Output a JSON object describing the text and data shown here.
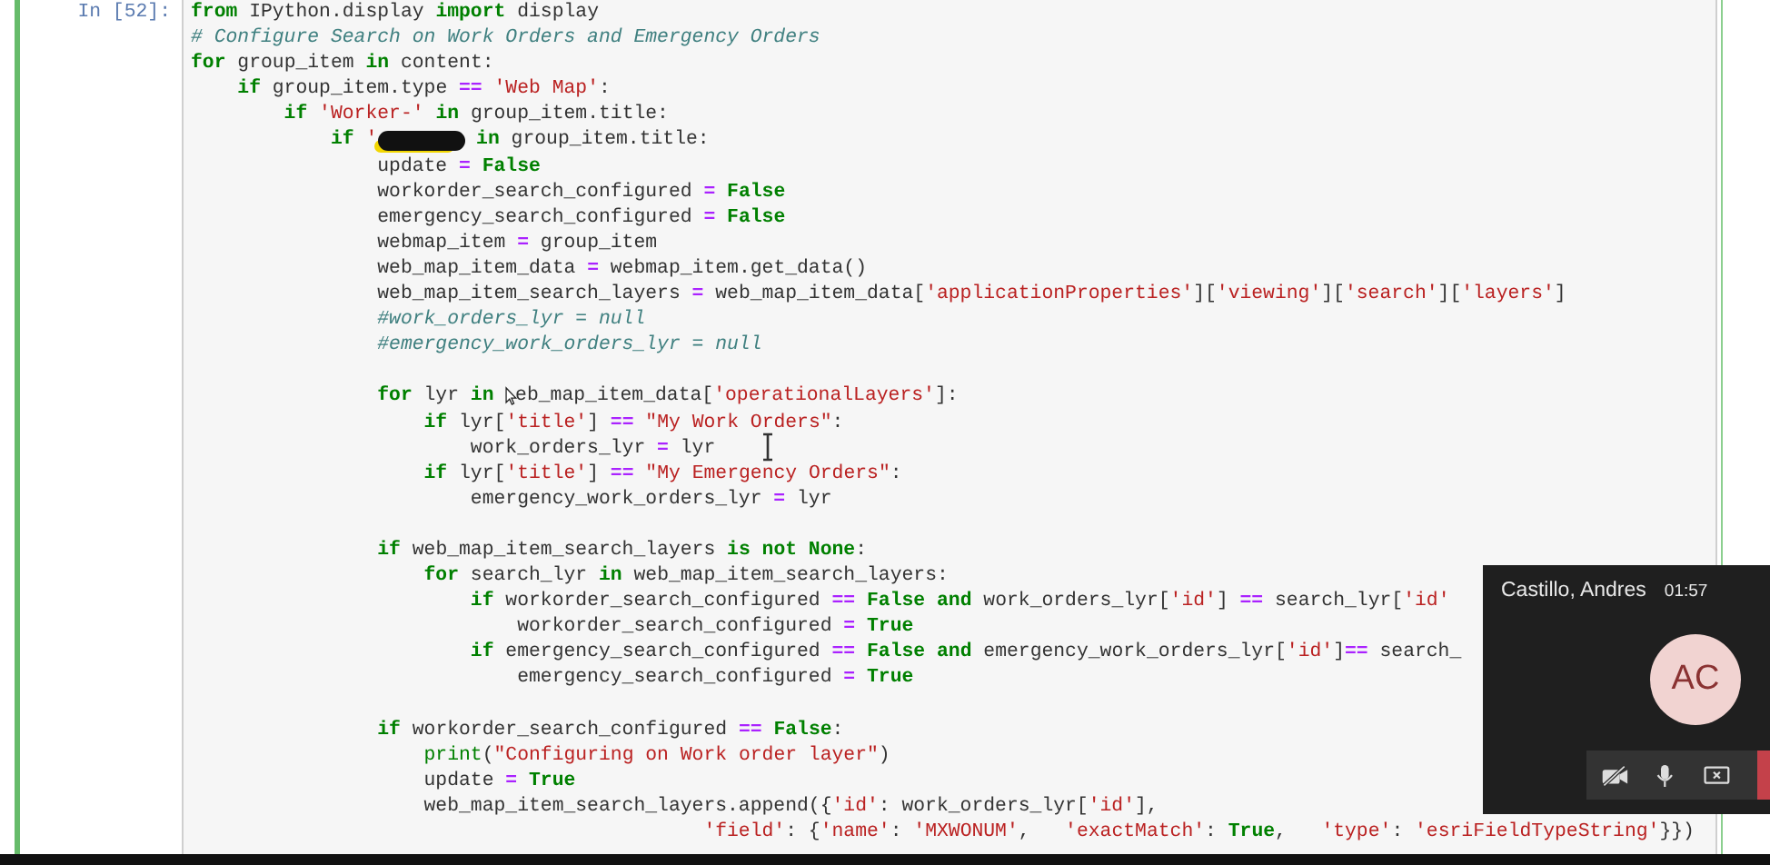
{
  "cell": {
    "prompt": "In [52]:",
    "blocks": [
      [
        [
          {
            "kind": "kw",
            "text": "from"
          },
          {
            "kind": "txt",
            "text": " IPython.display"
          },
          {
            "kind": "kw",
            "text": " import"
          },
          {
            "kind": "txt",
            "text": " display"
          }
        ],
        [
          {
            "kind": "com",
            "text": "# Configure Search on Work Orders and Emergency Orders"
          }
        ],
        [
          {
            "kind": "kw",
            "text": "for"
          },
          {
            "kind": "txt",
            "text": " group_item"
          },
          {
            "kind": "kw",
            "text": " in"
          },
          {
            "kind": "txt",
            "text": " content:"
          }
        ],
        [
          {
            "kind": "kw",
            "text": "    if"
          },
          {
            "kind": "txt",
            "text": " group_item.type"
          },
          {
            "kind": "op",
            "text": " =="
          },
          {
            "kind": "str",
            "text": " 'Web Map'"
          },
          {
            "kind": "txt",
            "text": ":"
          }
        ],
        [
          {
            "kind": "kw",
            "text": "        if"
          },
          {
            "kind": "str",
            "text": " 'Worker-'"
          },
          {
            "kind": "kw",
            "text": " in"
          },
          {
            "kind": "txt",
            "text": " group_item.title:"
          }
        ],
        [
          {
            "kind": "kw",
            "text": "            if"
          },
          {
            "kind": "str",
            "text": " '"
          },
          {
            "kind": "redact"
          },
          {
            "kind": "kw",
            "text": " in"
          },
          {
            "kind": "txt",
            "text": " group_item.title:"
          }
        ],
        [
          {
            "kind": "txt",
            "text": "                update"
          },
          {
            "kind": "op",
            "text": " ="
          },
          {
            "kind": "kw",
            "text": " False"
          }
        ],
        [
          {
            "kind": "txt",
            "text": "                workorder_search_configured"
          },
          {
            "kind": "op",
            "text": " ="
          },
          {
            "kind": "kw",
            "text": " False"
          }
        ],
        [
          {
            "kind": "txt",
            "text": "                emergency_search_configured"
          },
          {
            "kind": "op",
            "text": " ="
          },
          {
            "kind": "kw",
            "text": " False"
          }
        ],
        [
          {
            "kind": "txt",
            "text": "                webmap_item"
          },
          {
            "kind": "op",
            "text": " ="
          },
          {
            "kind": "txt",
            "text": " group_item"
          }
        ],
        [
          {
            "kind": "txt",
            "text": "                web_map_item_data"
          },
          {
            "kind": "op",
            "text": " ="
          },
          {
            "kind": "txt",
            "text": " webmap_item.get_data()"
          }
        ],
        [
          {
            "kind": "txt",
            "text": "                web_map_item_search_layers"
          },
          {
            "kind": "op",
            "text": " ="
          },
          {
            "kind": "txt",
            "text": " web_map_item_data["
          },
          {
            "kind": "str",
            "text": "'applicationProperties'"
          },
          {
            "kind": "txt",
            "text": "]["
          },
          {
            "kind": "str",
            "text": "'viewing'"
          },
          {
            "kind": "txt",
            "text": "]["
          },
          {
            "kind": "str",
            "text": "'search'"
          },
          {
            "kind": "txt",
            "text": "]["
          },
          {
            "kind": "str",
            "text": "'layers'"
          },
          {
            "kind": "txt",
            "text": "]"
          }
        ],
        [
          {
            "kind": "com",
            "text": "                #work_orders_lyr = null"
          }
        ],
        [
          {
            "kind": "com",
            "text": "                #emergency_work_orders_lyr = null"
          }
        ]
      ],
      [
        [
          {
            "kind": "kw",
            "text": "                for"
          },
          {
            "kind": "txt",
            "text": " lyr"
          },
          {
            "kind": "kw",
            "text": " in"
          },
          {
            "kind": "pointer"
          },
          {
            "kind": "txt",
            "text": "eb_map_item_data["
          },
          {
            "kind": "str",
            "text": "'operationalLayers'"
          },
          {
            "kind": "txt",
            "text": "]:"
          }
        ],
        [
          {
            "kind": "kw",
            "text": "                    if"
          },
          {
            "kind": "txt",
            "text": " lyr["
          },
          {
            "kind": "str",
            "text": "'title'"
          },
          {
            "kind": "txt",
            "text": "]"
          },
          {
            "kind": "op",
            "text": " =="
          },
          {
            "kind": "str",
            "text": " \"My Work Orders\""
          },
          {
            "kind": "txt",
            "text": ":"
          }
        ],
        [
          {
            "kind": "txt",
            "text": "                        work_orders_lyr"
          },
          {
            "kind": "op",
            "text": " ="
          },
          {
            "kind": "txt",
            "text": " lyr"
          }
        ],
        [
          {
            "kind": "kw",
            "text": "                    if"
          },
          {
            "kind": "txt",
            "text": " lyr["
          },
          {
            "kind": "str",
            "text": "'title'"
          },
          {
            "kind": "txt",
            "text": "]"
          },
          {
            "kind": "op",
            "text": " =="
          },
          {
            "kind": "str",
            "text": " \"My Emergency Orders\""
          },
          {
            "kind": "txt",
            "text": ":"
          }
        ],
        [
          {
            "kind": "txt",
            "text": "                        emergency_work_orders_lyr"
          },
          {
            "kind": "op",
            "text": " ="
          },
          {
            "kind": "txt",
            "text": " lyr"
          }
        ]
      ],
      [
        [
          {
            "kind": "kw",
            "text": "                if"
          },
          {
            "kind": "txt",
            "text": " web_map_item_search_layers"
          },
          {
            "kind": "kw",
            "text": " is not None"
          },
          {
            "kind": "txt",
            "text": ":"
          }
        ],
        [
          {
            "kind": "kw",
            "text": "                    for"
          },
          {
            "kind": "txt",
            "text": " search_lyr"
          },
          {
            "kind": "kw",
            "text": " in"
          },
          {
            "kind": "txt",
            "text": " web_map_item_search_layers:"
          }
        ],
        [
          {
            "kind": "kw",
            "text": "                        if"
          },
          {
            "kind": "txt",
            "text": " workorder_search_configured"
          },
          {
            "kind": "op",
            "text": " =="
          },
          {
            "kind": "kw",
            "text": " False and"
          },
          {
            "kind": "txt",
            "text": " work_orders_lyr["
          },
          {
            "kind": "str",
            "text": "'id'"
          },
          {
            "kind": "txt",
            "text": "]"
          },
          {
            "kind": "op",
            "text": " =="
          },
          {
            "kind": "txt",
            "text": " search_lyr["
          },
          {
            "kind": "str",
            "text": "'id'"
          }
        ],
        [
          {
            "kind": "txt",
            "text": "                            workorder_search_configured"
          },
          {
            "kind": "op",
            "text": " ="
          },
          {
            "kind": "kw",
            "text": " True"
          }
        ],
        [
          {
            "kind": "kw",
            "text": "                        if"
          },
          {
            "kind": "txt",
            "text": " emergency_search_configured"
          },
          {
            "kind": "op",
            "text": " =="
          },
          {
            "kind": "kw",
            "text": " False and"
          },
          {
            "kind": "txt",
            "text": " emergency_work_orders_lyr["
          },
          {
            "kind": "str",
            "text": "'id'"
          },
          {
            "kind": "txt",
            "text": "]"
          },
          {
            "kind": "op",
            "text": "=="
          },
          {
            "kind": "txt",
            "text": " search_"
          }
        ],
        [
          {
            "kind": "txt",
            "text": "                            emergency_search_configured"
          },
          {
            "kind": "op",
            "text": " ="
          },
          {
            "kind": "kw",
            "text": " True"
          }
        ]
      ],
      [
        [
          {
            "kind": "kw",
            "text": "                if"
          },
          {
            "kind": "txt",
            "text": " workorder_search_configured"
          },
          {
            "kind": "op",
            "text": " =="
          },
          {
            "kind": "kw",
            "text": " False"
          },
          {
            "kind": "txt",
            "text": ":"
          }
        ],
        [
          {
            "kind": "bi",
            "text": "                    print"
          },
          {
            "kind": "txt",
            "text": "("
          },
          {
            "kind": "str",
            "text": "\"Configuring on Work order layer\""
          },
          {
            "kind": "txt",
            "text": ")"
          }
        ],
        [
          {
            "kind": "txt",
            "text": "                    update"
          },
          {
            "kind": "op",
            "text": " ="
          },
          {
            "kind": "kw",
            "text": " True"
          }
        ],
        [
          {
            "kind": "txt",
            "text": "                    web_map_item_search_layers.append({"
          },
          {
            "kind": "str",
            "text": "'id'"
          },
          {
            "kind": "txt",
            "text": ": work_orders_lyr["
          },
          {
            "kind": "str",
            "text": "'id'"
          },
          {
            "kind": "txt",
            "text": "],"
          }
        ],
        [
          {
            "kind": "str",
            "text": "                                            'field'"
          },
          {
            "kind": "txt",
            "text": ": {"
          },
          {
            "kind": "str",
            "text": "'name'"
          },
          {
            "kind": "txt",
            "text": ":"
          },
          {
            "kind": "str",
            "text": " 'MXWONUM'"
          },
          {
            "kind": "txt",
            "text": ","
          },
          {
            "kind": "str",
            "text": "   'exactMatch'"
          },
          {
            "kind": "txt",
            "text": ":"
          },
          {
            "kind": "kw",
            "text": " True"
          },
          {
            "kind": "txt",
            "text": ","
          },
          {
            "kind": "str",
            "text": "   'type'"
          },
          {
            "kind": "txt",
            "text": ":"
          },
          {
            "kind": "str",
            "text": " 'esriFieldTypeString'"
          },
          {
            "kind": "txt",
            "text": "}})"
          }
        ]
      ]
    ]
  },
  "call": {
    "name": "Castillo, Andres",
    "time": "01:57",
    "initials": "AC"
  }
}
